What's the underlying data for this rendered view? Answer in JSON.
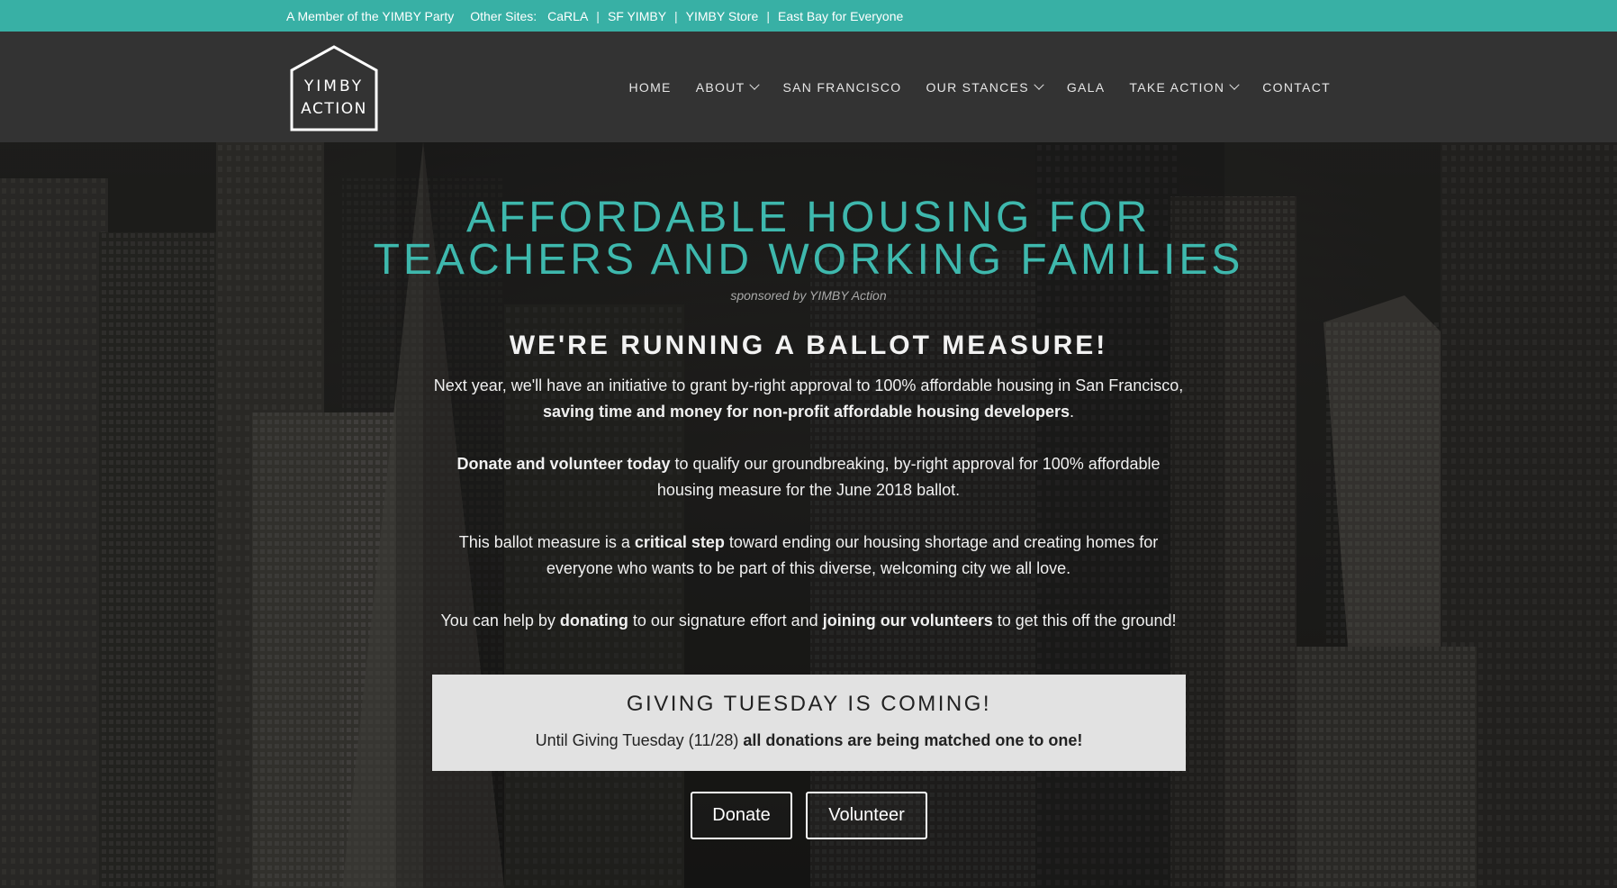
{
  "topbar": {
    "member_text": "A Member of the YIMBY Party",
    "other_sites_label": "Other Sites:",
    "sites": [
      "CaRLA",
      "SF YIMBY",
      "YIMBY Store",
      "East Bay for Everyone"
    ],
    "separator": "|",
    "background_color": "#38b0a5"
  },
  "header": {
    "logo_line1": "YIMBY",
    "logo_line2": "ACTION",
    "nav": [
      {
        "label": "HOME",
        "dropdown": false
      },
      {
        "label": "ABOUT",
        "dropdown": true
      },
      {
        "label": "SAN FRANCISCO",
        "dropdown": false
      },
      {
        "label": "OUR STANCES",
        "dropdown": true
      },
      {
        "label": "GALA",
        "dropdown": false
      },
      {
        "label": "TAKE ACTION",
        "dropdown": true
      },
      {
        "label": "CONTACT",
        "dropdown": false
      }
    ]
  },
  "hero": {
    "headline_line1": "AFFORDABLE HOUSING FOR",
    "headline_line2": "TEACHERS AND WORKING FAMILIES",
    "sponsor": "sponsored by YIMBY Action",
    "subheadline": "WE'RE RUNNING A BALLOT MEASURE!",
    "accent_color": "#3eb8ad",
    "p1_a": "Next year, we'll have an initiative to grant by-right approval to 100% affordable housing in San Francisco,",
    "p1_b": "saving time and money for non-profit affordable housing developers",
    "p1_c": ".",
    "p2_a": "Donate and volunteer today",
    "p2_b": " to qualify our groundbreaking, by-right approval for 100% affordable",
    "p2_c": "housing measure for the June 2018 ballot.",
    "p3_a": "This ballot measure is a ",
    "p3_b": "critical step",
    "p3_c": " toward ending our housing shortage and creating homes for",
    "p3_d": "everyone who wants to be part of this diverse, welcoming city we all love.",
    "p4_a": "You can help by ",
    "p4_b": "donating",
    "p4_c": " to our signature effort and ",
    "p4_d": "joining our volunteers",
    "p4_e": " to get this off the ground!"
  },
  "giving": {
    "title": "GIVING TUESDAY IS COMING!",
    "text_a": "Until Giving Tuesday (11/28) ",
    "text_b": "all donations are being matched one to one!"
  },
  "buttons": {
    "donate": "Donate",
    "volunteer": "Volunteer"
  }
}
